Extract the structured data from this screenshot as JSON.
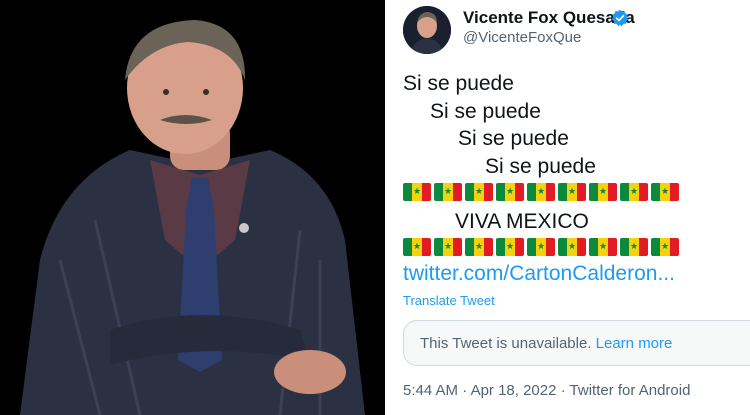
{
  "photo": {
    "alt": "Portrait photo"
  },
  "tweet": {
    "display_name": "Vicente Fox Quesada",
    "handle": "@VicenteFoxQue",
    "lines": [
      "Si se puede",
      "Si se puede",
      "Si se puede",
      "Si se puede"
    ],
    "flag_emoji": "🇸🇳",
    "flag_count": 9,
    "shout": "VIVA MEXICO",
    "link": "twitter.com/CartonCalderon...",
    "translate_label": "Translate Tweet",
    "quoted": {
      "text": "This Tweet is unavailable.",
      "learn_more": "Learn more"
    },
    "timestamp": "5:44 AM",
    "date": "Apr 18, 2022",
    "source": "Twitter for Android"
  },
  "colors": {
    "link_blue": "#1d9bf0",
    "verified_blue": "#1d9bf0",
    "text": "#0f1419",
    "muted": "#536471"
  },
  "icons": {
    "verified": "verified-badge-icon"
  }
}
